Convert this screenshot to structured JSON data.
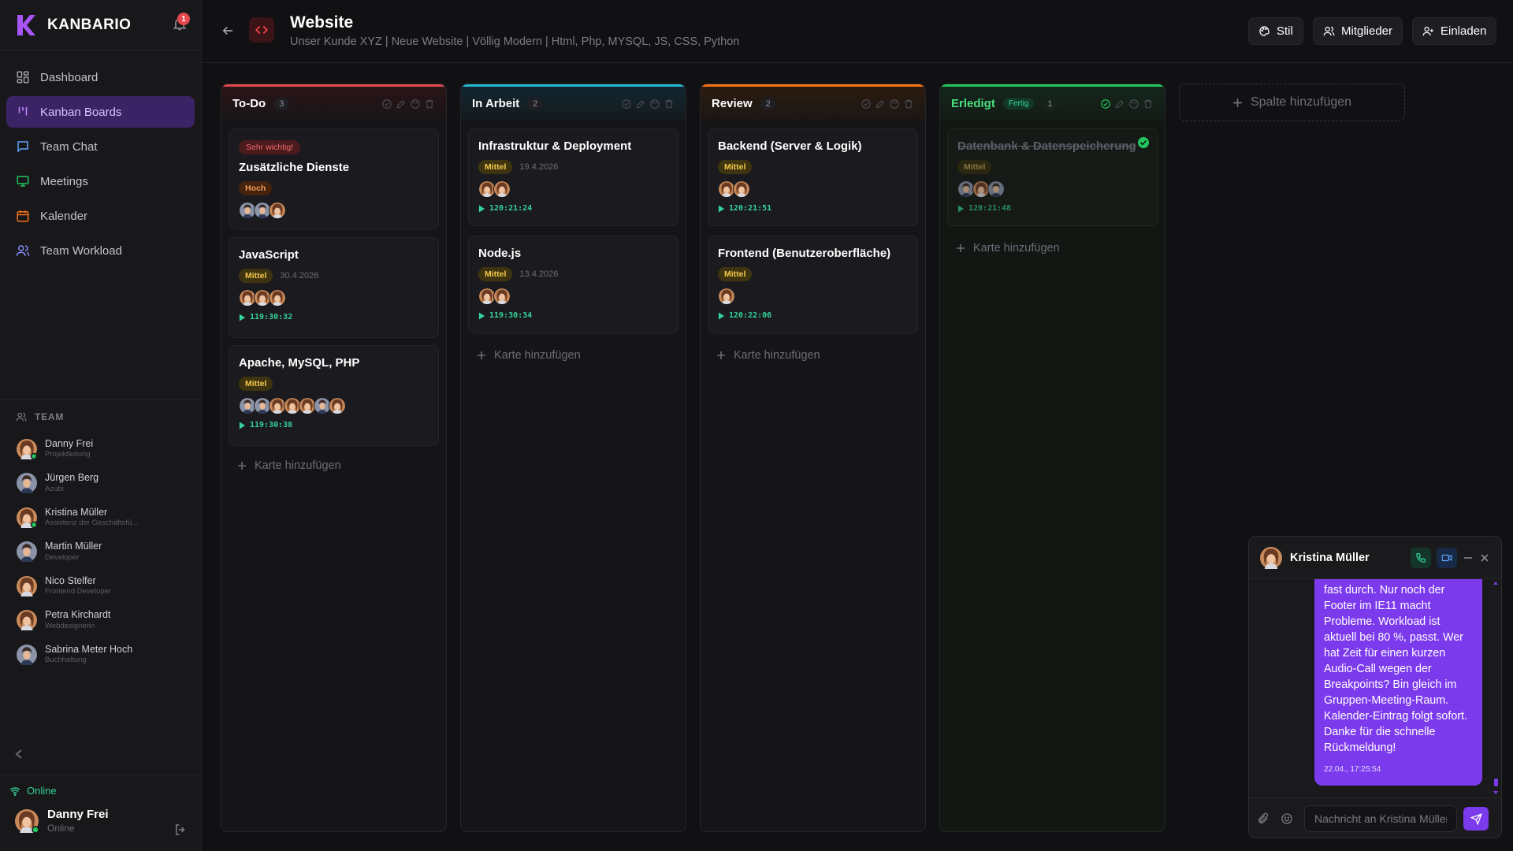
{
  "app": {
    "name": "KANBARIO",
    "notifications": "1"
  },
  "nav": [
    {
      "label": "Dashboard",
      "icon": "dashboard-icon",
      "active": false
    },
    {
      "label": "Kanban Boards",
      "icon": "kanban-icon",
      "active": true
    },
    {
      "label": "Team Chat",
      "icon": "chat-icon",
      "active": false
    },
    {
      "label": "Meetings",
      "icon": "monitor-icon",
      "active": false
    },
    {
      "label": "Kalender",
      "icon": "calendar-icon",
      "active": false
    },
    {
      "label": "Team Workload",
      "icon": "users-icon",
      "active": false
    }
  ],
  "team": {
    "title": "TEAM",
    "members": [
      {
        "name": "Danny Frei",
        "role": "Projektleitung",
        "online": true
      },
      {
        "name": "Jürgen Berg",
        "role": "Azubi",
        "online": false
      },
      {
        "name": "Kristina Müller",
        "role": "Assistenz der Geschäftsfü...",
        "online": true
      },
      {
        "name": "Martin Müller",
        "role": "Developer",
        "online": false
      },
      {
        "name": "Nico Stelfer",
        "role": "Frontend Developer",
        "online": false
      },
      {
        "name": "Petra Kirchardt",
        "role": "Webdesignerin",
        "online": false
      },
      {
        "name": "Sabrina Meter Hoch",
        "role": "Buchhaltung",
        "online": false
      }
    ]
  },
  "footer": {
    "status": "Online",
    "user_name": "Danny Frei",
    "user_status": "Online"
  },
  "header": {
    "title": "Website",
    "subtitle": "Unser Kunde XYZ | Neue Website | Völlig Modern | Html, Php, MYSQL, JS, CSS, Python",
    "btn_style": "Stil",
    "btn_members": "Mitglieder",
    "btn_invite": "Einladen"
  },
  "board": {
    "add_card": "Karte hinzufügen",
    "add_column": "Spalte hinzufügen",
    "columns": [
      {
        "title": "To-Do",
        "count": "3",
        "accent": "#e5484d",
        "cards": [
          {
            "tag": "Sehr wichtig!",
            "title": "Zusätzliche Dienste",
            "priority": "Hoch"
          },
          {
            "title": "JavaScript",
            "priority": "Mittel",
            "date": "30.4.2026",
            "timer": "119:30:32"
          },
          {
            "title": "Apache, MySQL, PHP",
            "priority": "Mittel",
            "timer": "119:30:38"
          }
        ]
      },
      {
        "title": "In Arbeit",
        "count": "2",
        "accent": "#22b8cf",
        "cards": [
          {
            "title": "Infrastruktur & Deployment",
            "priority": "Mittel",
            "date": "19.4.2026",
            "timer": "120:21:24"
          },
          {
            "title": "Node.js",
            "priority": "Mittel",
            "date": "13.4.2026",
            "timer": "119:30:34"
          }
        ]
      },
      {
        "title": "Review",
        "count": "2",
        "accent": "#f97316",
        "cards": [
          {
            "title": "Backend (Server & Logik)",
            "priority": "Mittel",
            "timer": "120:21:51"
          },
          {
            "title": "Frontend (Benutzeroberfläche)",
            "priority": "Mittel",
            "timer": "120:22:06"
          }
        ]
      },
      {
        "title": "Erledigt",
        "badge": "Fertig",
        "count": "1",
        "accent": "#22c55e",
        "cards": [
          {
            "title": "Datenbank & Datenspeicherung",
            "priority": "Mittel",
            "timer": "120:21:48"
          }
        ]
      }
    ]
  },
  "chat": {
    "name": "Kristina Müller",
    "message": "fast durch. Nur noch der Footer im IE11 macht Probleme. Workload ist aktuell bei 80 %, passt. Wer hat Zeit für einen kurzen Audio-Call wegen der Breakpoints? Bin gleich im Gruppen-Meeting-Raum. Kalender-Eintrag folgt sofort. Danke für die schnelle Rückmeldung!",
    "time": "22.04., 17:25:54",
    "placeholder": "Nachricht an Kristina Müller"
  },
  "colors": {
    "accent": "#7c3aed",
    "success": "#34d399"
  }
}
